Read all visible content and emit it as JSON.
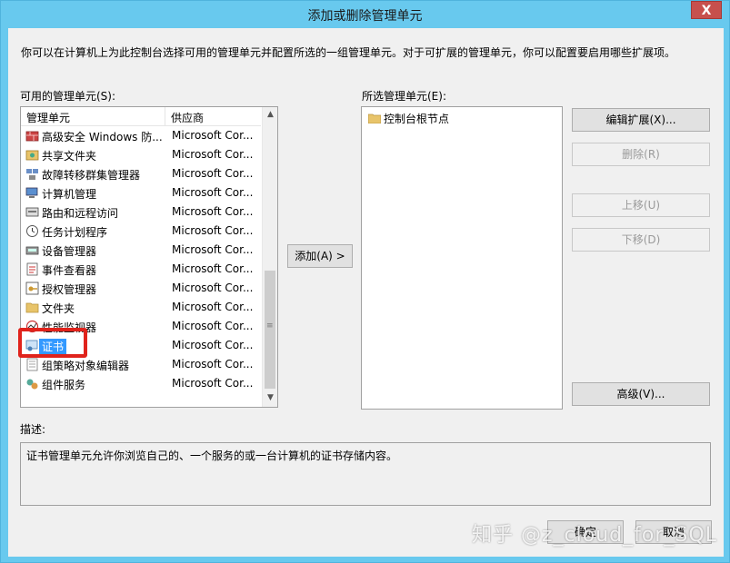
{
  "window": {
    "title": "添加或删除管理单元",
    "close_label": "X"
  },
  "intro_text": "你可以在计算机上为此控制台选择可用的管理单元并配置所选的一组管理单元。对于可扩展的管理单元，你可以配置要启用哪些扩展项。",
  "available": {
    "label": "可用的管理单元(S):",
    "col_name": "管理单元",
    "col_vendor": "供应商",
    "items": [
      {
        "name": "高级安全 Windows 防...",
        "vendor": "Microsoft Cor...",
        "icon": "firewall-icon"
      },
      {
        "name": "共享文件夹",
        "vendor": "Microsoft Cor...",
        "icon": "shared-folder-icon"
      },
      {
        "name": "故障转移群集管理器",
        "vendor": "Microsoft Cor...",
        "icon": "cluster-icon"
      },
      {
        "name": "计算机管理",
        "vendor": "Microsoft Cor...",
        "icon": "computer-management-icon"
      },
      {
        "name": "路由和远程访问",
        "vendor": "Microsoft Cor...",
        "icon": "routing-icon"
      },
      {
        "name": "任务计划程序",
        "vendor": "Microsoft Cor...",
        "icon": "clock-icon"
      },
      {
        "name": "设备管理器",
        "vendor": "Microsoft Cor...",
        "icon": "device-manager-icon"
      },
      {
        "name": "事件查看器",
        "vendor": "Microsoft Cor...",
        "icon": "event-viewer-icon"
      },
      {
        "name": "授权管理器",
        "vendor": "Microsoft Cor...",
        "icon": "authorization-icon"
      },
      {
        "name": "文件夹",
        "vendor": "Microsoft Cor...",
        "icon": "folder-icon"
      },
      {
        "name": "性能监视器",
        "vendor": "Microsoft Cor...",
        "icon": "performance-icon"
      },
      {
        "name": "证书",
        "vendor": "Microsoft Cor...",
        "icon": "certificate-icon",
        "selected": true
      },
      {
        "name": "组策略对象编辑器",
        "vendor": "Microsoft Cor...",
        "icon": "group-policy-icon"
      },
      {
        "name": "组件服务",
        "vendor": "Microsoft Cor...",
        "icon": "component-services-icon"
      }
    ]
  },
  "add_button": "添加(A) >",
  "selected": {
    "label": "所选管理单元(E):",
    "items": [
      {
        "name": "控制台根节点",
        "icon": "folder-icon"
      }
    ]
  },
  "right_buttons": {
    "edit_extensions": "编辑扩展(X)...",
    "remove": "删除(R)",
    "move_up": "上移(U)",
    "move_down": "下移(D)",
    "advanced": "高级(V)..."
  },
  "description": {
    "label": "描述:",
    "text": "证书管理单元允许你浏览自己的、一个服务的或一台计算机的证书存储内容。"
  },
  "footer": {
    "ok": "确定",
    "cancel": "取消"
  },
  "watermark": "知乎 @z_cloud_for_SQL"
}
